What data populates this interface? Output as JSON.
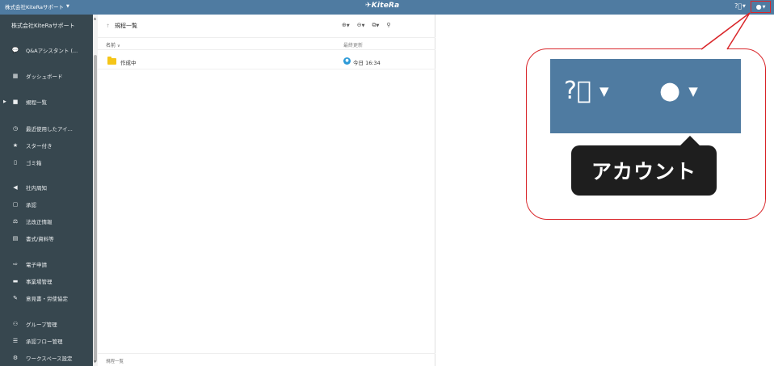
{
  "topbar": {
    "org_label": "株式会社KiteRaサポート",
    "logo": "KiteRa",
    "help_icon": "question-circle-icon",
    "account_icon": "user-circle-icon"
  },
  "sidebar": {
    "org_name": "株式会社KiteRaサポート",
    "items": [
      {
        "label": "Q&Aアシスタント (...",
        "icon": "chat-icon"
      },
      {
        "label": "ダッシュボード",
        "icon": "dashboard-icon"
      },
      {
        "label": "規程一覧",
        "icon": "folder-icon"
      },
      {
        "label": "最近使用したアイ...",
        "icon": "clock-icon"
      },
      {
        "label": "スター付き",
        "icon": "star-icon"
      },
      {
        "label": "ゴミ箱",
        "icon": "trash-icon"
      },
      {
        "label": "社内周知",
        "icon": "megaphone-icon"
      },
      {
        "label": "承認",
        "icon": "approve-icon"
      },
      {
        "label": "法改正情報",
        "icon": "scale-icon"
      },
      {
        "label": "書式/資料等",
        "icon": "document-icon"
      },
      {
        "label": "電子申請",
        "icon": "e-application-icon"
      },
      {
        "label": "事業場管理",
        "icon": "building-icon"
      },
      {
        "label": "意見書・労使協定",
        "icon": "pen-icon"
      },
      {
        "label": "グループ管理",
        "icon": "group-icon"
      },
      {
        "label": "承認フロー管理",
        "icon": "flow-icon"
      },
      {
        "label": "ワークスペース設定",
        "icon": "gear-icon"
      }
    ]
  },
  "main": {
    "breadcrumb": "規程一覧",
    "col_name": "名前",
    "col_updated": "最終更新",
    "rows": [
      {
        "name": "作成中",
        "updated": "今日 16:34"
      }
    ],
    "footer": "規程一覧"
  },
  "callout": {
    "tooltip": "アカウント"
  },
  "colors": {
    "topbar": "#4f7ba1",
    "sidebar": "#37474f",
    "highlight": "#d9262a",
    "folder": "#f5c518"
  }
}
